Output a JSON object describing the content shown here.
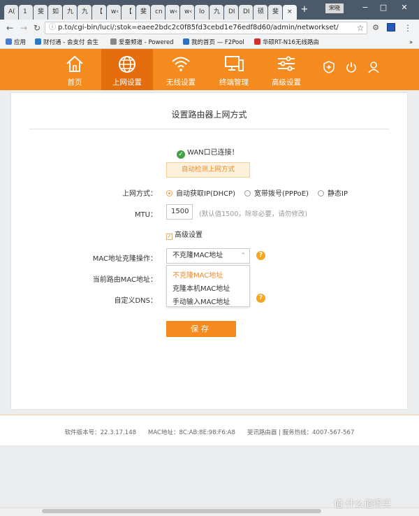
{
  "browser": {
    "tabs": [
      "A(",
      "1⁩",
      "斐",
      "如",
      "九",
      "九",
      "【",
      "w‹",
      "【",
      "斐",
      "cn",
      "w‹",
      "w‹",
      "lo",
      "九",
      "DI",
      "DI",
      "硕",
      "斐",
      "×"
    ],
    "new_tab": "+",
    "profile_label": "宋晓",
    "window_controls": [
      "−",
      "□",
      "✕"
    ],
    "url": "p.to/cgi-bin/luci/;stok=eaee2bdc2c0f85fd3cebd1e76edf8d60/admin/networkset/",
    "bookmarks": [
      {
        "label": "应用",
        "icon": "apps-grid-icon",
        "color": "#4a7bd0"
      },
      {
        "label": "财付通 - 会支付 会生",
        "icon": "shield-icon",
        "color": "#2b7ac4"
      },
      {
        "label": "爱蚕频道 - Powered",
        "icon": "page-icon",
        "color": "#888888"
      },
      {
        "label": "我的首页 — F2Pool",
        "icon": "f2pool-icon",
        "color": "#2f6fc2"
      },
      {
        "label": "华硕RT-N16无线路由",
        "icon": "asus-icon",
        "color": "#d0312d"
      }
    ],
    "bookmarks_more": "»"
  },
  "router_nav": {
    "items": [
      {
        "label": "首页",
        "icon": "home-icon"
      },
      {
        "label": "上网设置",
        "icon": "globe-icon",
        "active": true
      },
      {
        "label": "无线设置",
        "icon": "wifi-icon"
      },
      {
        "label": "终端管理",
        "icon": "monitor-icon"
      },
      {
        "label": "高级设置",
        "icon": "sliders-icon"
      }
    ],
    "accent": "#f58b1f"
  },
  "form": {
    "title": "设置路由器上网方式",
    "wan_status": "WAN口已连接！",
    "autodetect_label": "自动检测上网方式",
    "conn_type_label": "上网方式：",
    "conn_options": [
      "自动获取IP(DHCP)",
      "宽带拨号(PPPoE)",
      "静态IP"
    ],
    "mtu_label": "MTU：",
    "mtu_value": "1500",
    "mtu_hint": "(默认值1500，除非必要，请勿修改)",
    "advanced_label": "高级设置",
    "mac_clone_label": "MAC地址克隆操作：",
    "mac_clone_value": "不克隆MAC地址",
    "mac_clone_options": [
      "不克隆MAC地址",
      "克隆本机MAC地址",
      "手动输入MAC地址"
    ],
    "current_mac_label": "当前路由MAC地址：",
    "dns_label": "自定义DNS：",
    "save_label": "保存"
  },
  "footer": {
    "text": "软件版本号：22.3.17.148　　MAC地址：8C:AB:8E:98:F6:A8　　斐讯路由器 | 服务热线：4007-567-567"
  },
  "watermark": "值·什么值得买"
}
